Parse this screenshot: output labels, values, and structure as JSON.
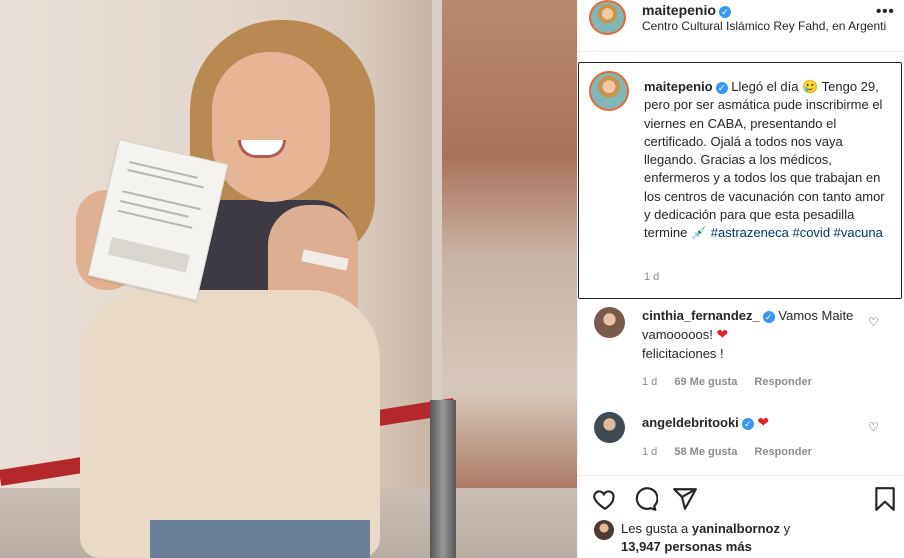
{
  "post": {
    "username": "maitepenio",
    "location": "Centro Cultural Islámico Rey Fahd, en Argentina",
    "more_label": "•••"
  },
  "caption": {
    "username": "maitepenio",
    "text_1": "Llegó el día 🥲 Tengo 29, pero por ser asmática pude inscribirme el viernes en CABA, presentando el certificado. Ojalá a todos nos vaya llegando. Gracias a los médicos, enfermeros y a todos los que trabajan en los centros de vacunación con tanto amor y dedicación para que esta pesadilla termine 💉",
    "hashtags": [
      "#astrazeneca",
      "#covid",
      "#vacuna"
    ],
    "time": "1 d"
  },
  "comments": [
    {
      "username": "cinthia_fernandez_",
      "text": "Vamos Maite vamooooos!",
      "text_after_heart": "felicitaciones !",
      "heart": "❤",
      "time": "1 d",
      "likes": "69 Me gusta",
      "reply": "Responder"
    },
    {
      "username": "angeldebritooki",
      "text": "",
      "heart": "❤",
      "time": "1 d",
      "likes": "58 Me gusta",
      "reply": "Responder"
    }
  ],
  "likes": {
    "prefix": "Les gusta a",
    "user": "yaninalbornoz",
    "suffix": "y",
    "count_line": "13,947 personas más"
  },
  "icons": {
    "verified": "verified-badge-icon",
    "like": "heart-outline-icon",
    "comment": "comment-bubble-icon",
    "share": "paper-plane-icon",
    "save": "bookmark-icon"
  },
  "colors": {
    "verified": "#3897f0",
    "hashtag": "#00376b",
    "muted": "#8e8e8e",
    "heart_red": "#e0242d"
  }
}
